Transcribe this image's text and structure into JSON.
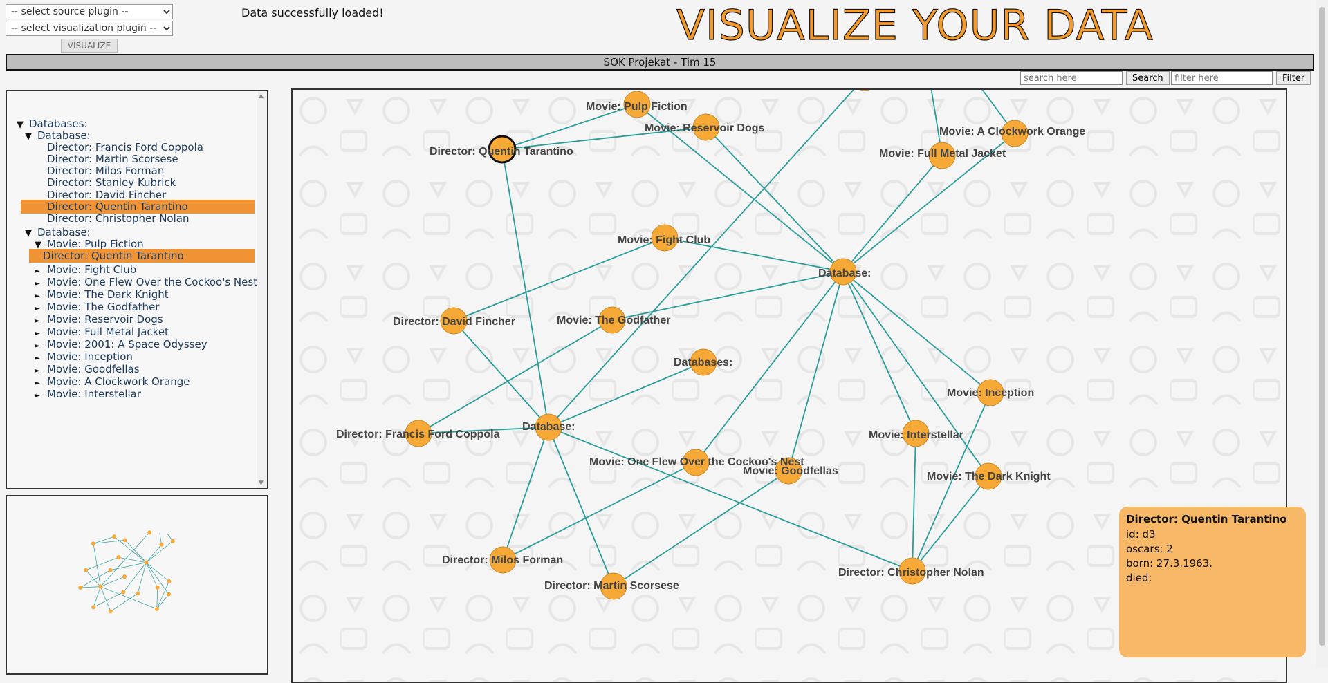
{
  "controls": {
    "source_placeholder": "-- select source plugin --",
    "viz_placeholder": "-- select visualization plugin --",
    "visualize_label": "VISUALIZE",
    "status": "Data successfully loaded!"
  },
  "brand": {
    "title": "VISUALIZE YOUR DATA",
    "color": "#f39a2e"
  },
  "project": {
    "title": "SOK Projekat - Tim 15"
  },
  "search": {
    "search_placeholder": "search here",
    "search_label": "Search",
    "filter_placeholder": "filter here",
    "filter_label": "Filter"
  },
  "tree": {
    "rows": [
      {
        "depth": 0,
        "expander": "down",
        "label": "Databases:"
      },
      {
        "depth": 1,
        "expander": "down",
        "label": "Database:"
      },
      {
        "depth": 2,
        "expander": "none",
        "label": "Director: Francis Ford Coppola"
      },
      {
        "depth": 2,
        "expander": "none",
        "label": "Director: Martin Scorsese"
      },
      {
        "depth": 2,
        "expander": "none",
        "label": "Director: Milos Forman"
      },
      {
        "depth": 2,
        "expander": "none",
        "label": "Director: Stanley Kubrick"
      },
      {
        "depth": 2,
        "expander": "none",
        "label": "Director: David Fincher"
      },
      {
        "depth": 2,
        "expander": "none",
        "label": "Director: Quentin Tarantino",
        "selected": true
      },
      {
        "depth": 2,
        "expander": "none",
        "label": "Director: Christopher Nolan"
      },
      {
        "depth": 1,
        "expander": "down",
        "label": "Database:"
      },
      {
        "depth": 2,
        "expander": "down",
        "label": "Movie: Pulp Fiction"
      },
      {
        "depth": 3,
        "expander": "none",
        "label": "Director: Quentin Tarantino",
        "selected": true
      },
      {
        "depth": 2,
        "expander": "right",
        "label": "Movie: Fight Club"
      },
      {
        "depth": 2,
        "expander": "right",
        "label": "Movie: One Flew Over the Cockoo's Nest"
      },
      {
        "depth": 2,
        "expander": "right",
        "label": "Movie: The Dark Knight"
      },
      {
        "depth": 2,
        "expander": "right",
        "label": "Movie: The Godfather"
      },
      {
        "depth": 2,
        "expander": "right",
        "label": "Movie: Reservoir Dogs"
      },
      {
        "depth": 2,
        "expander": "right",
        "label": "Movie: Full Metal Jacket"
      },
      {
        "depth": 2,
        "expander": "right",
        "label": "Movie: 2001: A Space Odyssey"
      },
      {
        "depth": 2,
        "expander": "right",
        "label": "Movie: Inception"
      },
      {
        "depth": 2,
        "expander": "right",
        "label": "Movie: Goodfellas"
      },
      {
        "depth": 2,
        "expander": "right",
        "label": "Movie: A Clockwork Orange"
      },
      {
        "depth": 2,
        "expander": "right",
        "label": "Movie: Interstellar"
      }
    ]
  },
  "graph": {
    "node_color": "#f7a937",
    "edge_color": "#2a9d9a",
    "selected_node": "qt",
    "nodes": [
      {
        "id": "pf",
        "label": "Movie: Pulp Fiction"
      },
      {
        "id": "rd",
        "label": "Movie: Reservoir Dogs"
      },
      {
        "id": "qt",
        "label": "Director: Quentin Tarantino"
      },
      {
        "id": "aco",
        "label": "Movie: A Clockwork Orange"
      },
      {
        "id": "fmj",
        "label": "Movie: Full Metal Jacket"
      },
      {
        "id": "fc",
        "label": "Movie: Fight Club"
      },
      {
        "id": "db1",
        "label": "Database:"
      },
      {
        "id": "df",
        "label": "Director: David Fincher"
      },
      {
        "id": "gf",
        "label": "Movie: The Godfather"
      },
      {
        "id": "dbs",
        "label": "Databases:"
      },
      {
        "id": "inc",
        "label": "Movie: Inception"
      },
      {
        "id": "ffc",
        "label": "Director: Francis Ford Coppola"
      },
      {
        "id": "db2",
        "label": "Database:"
      },
      {
        "id": "ist",
        "label": "Movie: Interstellar"
      },
      {
        "id": "ofo",
        "label": "Movie: One Flew Over the Cockoo's Nest"
      },
      {
        "id": "gfl",
        "label": "Movie: Goodfellas"
      },
      {
        "id": "dk",
        "label": "Movie: The Dark Knight"
      },
      {
        "id": "mf",
        "label": "Director: Milos Forman"
      },
      {
        "id": "cn",
        "label": "Director: Christopher Nolan"
      },
      {
        "id": "ms",
        "label": "Director: Martin Scorsese"
      },
      {
        "id": "top",
        "label": ""
      }
    ],
    "edges": [
      [
        "qt",
        "pf"
      ],
      [
        "qt",
        "rd"
      ],
      [
        "qt",
        "db2"
      ],
      [
        "pf",
        "db1"
      ],
      [
        "rd",
        "db1"
      ],
      [
        "fc",
        "db1"
      ],
      [
        "gf",
        "db1"
      ],
      [
        "inc",
        "db1"
      ],
      [
        "ist",
        "db1"
      ],
      [
        "dk",
        "db1"
      ],
      [
        "gfl",
        "db1"
      ],
      [
        "ofo",
        "db1"
      ],
      [
        "fmj",
        "db1"
      ],
      [
        "aco",
        "db1"
      ],
      [
        "top",
        "db2"
      ],
      [
        "df",
        "fc"
      ],
      [
        "df",
        "db2"
      ],
      [
        "ffc",
        "gf"
      ],
      [
        "ffc",
        "db2"
      ],
      [
        "dbs",
        "db2"
      ],
      [
        "db2",
        "mf"
      ],
      [
        "db2",
        "ms"
      ],
      [
        "db2",
        "cn"
      ],
      [
        "mf",
        "ofo"
      ],
      [
        "ms",
        "gfl"
      ],
      [
        "cn",
        "ist"
      ],
      [
        "cn",
        "inc"
      ],
      [
        "cn",
        "dk"
      ],
      [
        "fmj",
        "top2"
      ],
      [
        "aco",
        "top3"
      ]
    ]
  },
  "info": {
    "title": "Director: Quentin Tarantino",
    "lines": [
      "id: d3",
      "oscars: 2",
      "born: 27.3.1963.",
      "died:"
    ]
  }
}
